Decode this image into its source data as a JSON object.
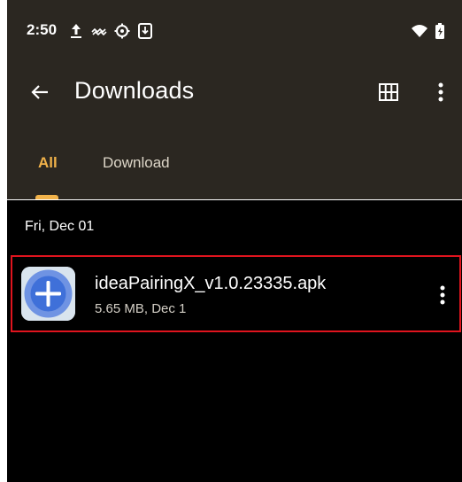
{
  "status_bar": {
    "time": "2:50",
    "icons": [
      "upload-icon",
      "wave-icon",
      "settings-gear-icon",
      "download-box-icon",
      "wifi-icon",
      "battery-icon"
    ]
  },
  "app_bar": {
    "back_icon": "arrow-left-icon",
    "title": "Downloads",
    "grid_icon": "grid-view-icon",
    "more_icon": "more-vertical-icon"
  },
  "tabs": [
    {
      "label": "All",
      "active": true
    },
    {
      "label": "Download",
      "active": false
    }
  ],
  "section": {
    "date_header": "Fri, Dec 01"
  },
  "files": [
    {
      "name": "ideaPairingX_v1.0.23335.apk",
      "meta": "5.65 MB, Dec 1",
      "icon": "app-plus-icon",
      "more_icon": "more-vertical-icon"
    }
  ],
  "colors": {
    "header_bg": "#2b2721",
    "content_bg": "#000000",
    "accent": "#f1b24a",
    "highlight_border": "#e0141e"
  }
}
